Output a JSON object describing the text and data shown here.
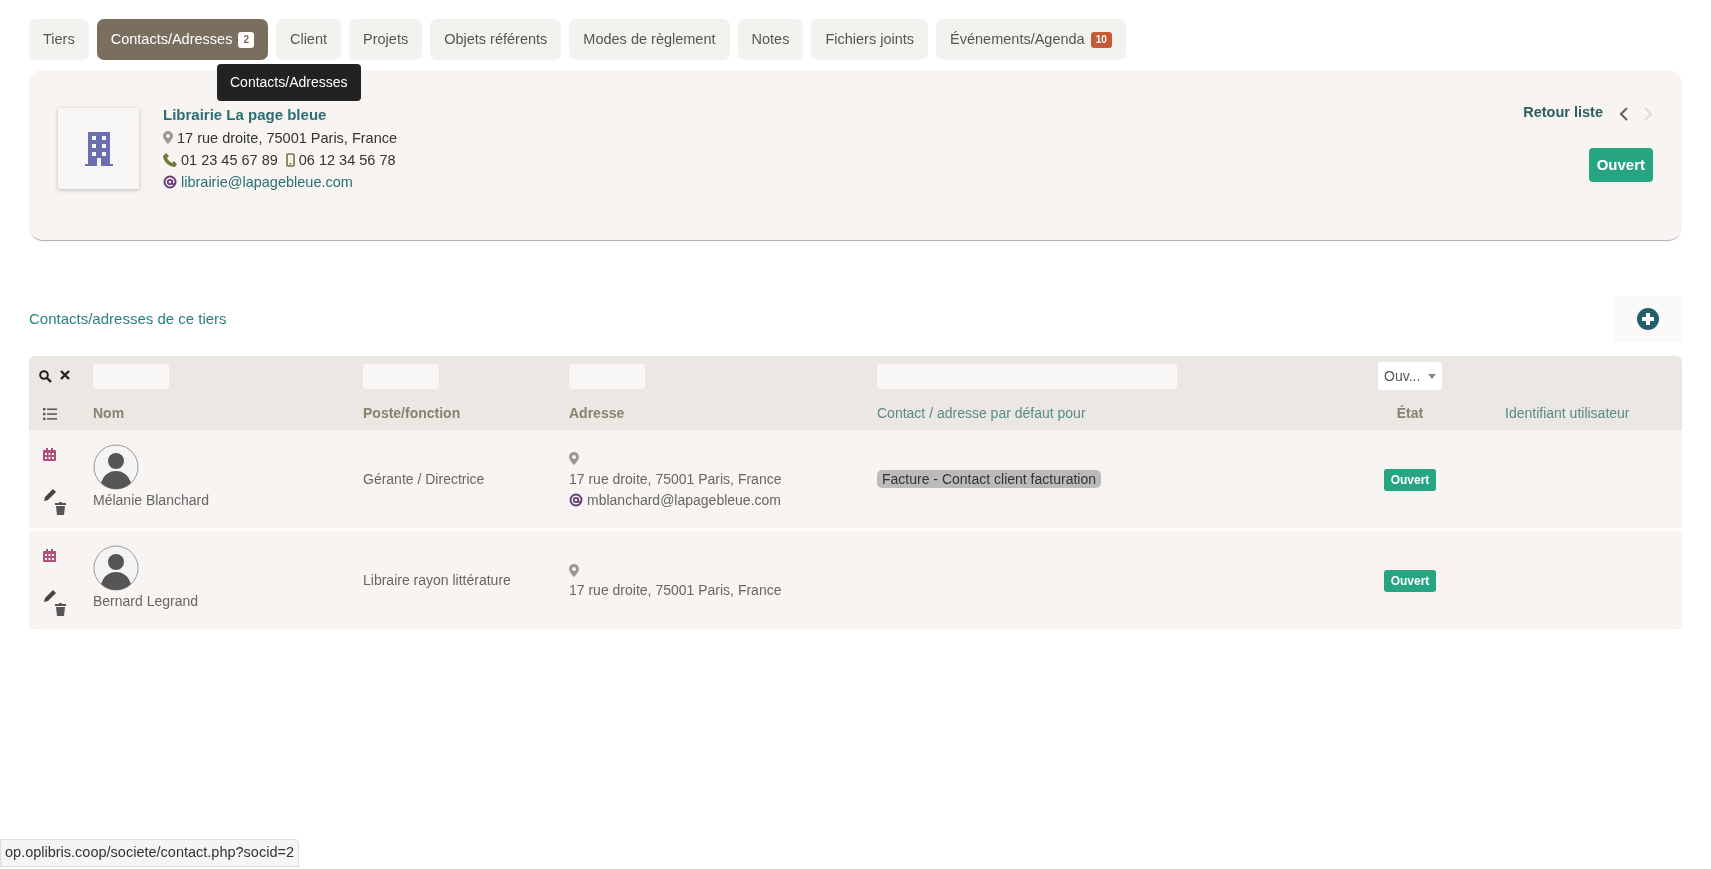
{
  "tabs": [
    {
      "label": "Tiers",
      "selected": false
    },
    {
      "label": "Contacts/Adresses",
      "selected": true,
      "badge": "2"
    },
    {
      "label": "Client",
      "selected": false
    },
    {
      "label": "Projets",
      "selected": false
    },
    {
      "label": "Objets référents",
      "selected": false
    },
    {
      "label": "Modes de règlement",
      "selected": false
    },
    {
      "label": "Notes",
      "selected": false
    },
    {
      "label": "Fichiers joints",
      "selected": false
    },
    {
      "label": "Événements/Agenda",
      "selected": false,
      "badge": "10"
    }
  ],
  "tooltip": "Contacts/Adresses",
  "company": {
    "name": "Librairie La page bleue",
    "address": "17 rue droite, 75001 Paris, France",
    "phone": "01 23 45 67 89",
    "mobile": "06 12 34 56 78",
    "email": "librairie@lapagebleue.com"
  },
  "nav": {
    "back": "Retour liste",
    "prev_disabled": false,
    "next_disabled": true
  },
  "status": "Ouvert",
  "section_title": "Contacts/adresses de ce tiers",
  "table": {
    "status_filter": "Ouv...",
    "columns": [
      {
        "label": "Nom",
        "sortable": true
      },
      {
        "label": "Poste/fonction",
        "sortable": true
      },
      {
        "label": "Adresse",
        "sortable": true
      },
      {
        "label": "Contact / adresse par défaut pour",
        "sortable": false
      },
      {
        "label": "État",
        "sortable": true
      },
      {
        "label": "Identifiant utilisateur",
        "sortable": false
      }
    ],
    "rows": [
      {
        "name": "Mélanie Blanchard",
        "position": "Gérante / Directrice",
        "address": "17 rue droite, 75001 Paris, France",
        "email": "mblanchard@lapagebleue.com",
        "default_for": "Facture - Contact client facturation",
        "status": "Ouvert"
      },
      {
        "name": "Bernard Legrand",
        "position": "Libraire rayon littérature",
        "address": "17 rue droite, 75001 Paris, France",
        "status": "Ouvert"
      }
    ]
  },
  "status_bar": "op.oplibris.coop/societe/contact.php?socid=2"
}
